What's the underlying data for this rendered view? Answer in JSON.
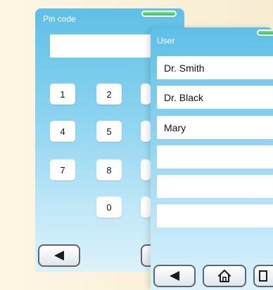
{
  "pin_panel": {
    "title": "Pin code",
    "display_value": "",
    "keys": [
      {
        "label": "1"
      },
      {
        "label": "2"
      },
      {
        "label": "4"
      },
      {
        "label": "5"
      },
      {
        "label": "7"
      },
      {
        "label": "8"
      },
      {
        "label": "0"
      }
    ]
  },
  "user_panel": {
    "title": "User",
    "users": [
      {
        "label": "Dr. Smith"
      },
      {
        "label": "Dr. Black"
      },
      {
        "label": "Mary"
      },
      {
        "label": ""
      },
      {
        "label": ""
      },
      {
        "label": ""
      }
    ]
  },
  "icons": {
    "back": "back-arrow-icon",
    "home": "home-icon",
    "status": "status-indicator"
  },
  "colors": {
    "panel_top": "#5fbfe6",
    "panel_bottom": "#dcf2fb",
    "status_green": "#2fbf4c",
    "background": "#fdf6e3"
  }
}
